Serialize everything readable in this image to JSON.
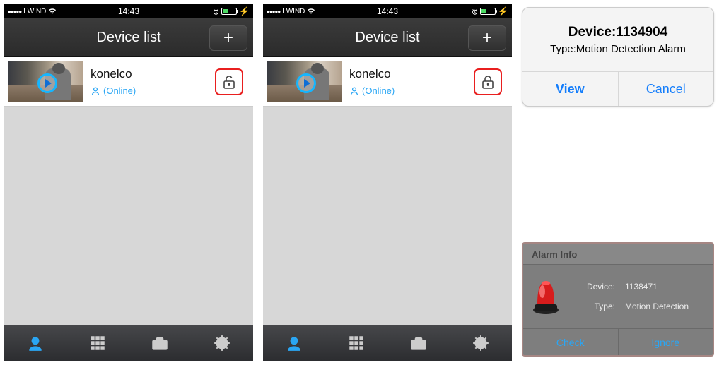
{
  "status": {
    "signal_dots_filled": 5,
    "carrier": "I WIND",
    "time": "14:43",
    "has_alarm": true,
    "has_lightning": true
  },
  "header": {
    "title": "Device list",
    "add_label": "+"
  },
  "device": {
    "name": "konelco",
    "status": "(Online)"
  },
  "phones": [
    {
      "lock_state": "unlocked"
    },
    {
      "lock_state": "locked"
    }
  ],
  "ios_alert": {
    "title": "Device:1134904",
    "subtitle": "Type:Motion Detection Alarm",
    "view": "View",
    "cancel": "Cancel"
  },
  "alarm_card": {
    "header": "Alarm Info",
    "device_label": "Device:",
    "device_value": "1138471",
    "type_label": "Type:",
    "type_value": "Motion Detection",
    "check": "Check",
    "ignore": "Ignore"
  }
}
